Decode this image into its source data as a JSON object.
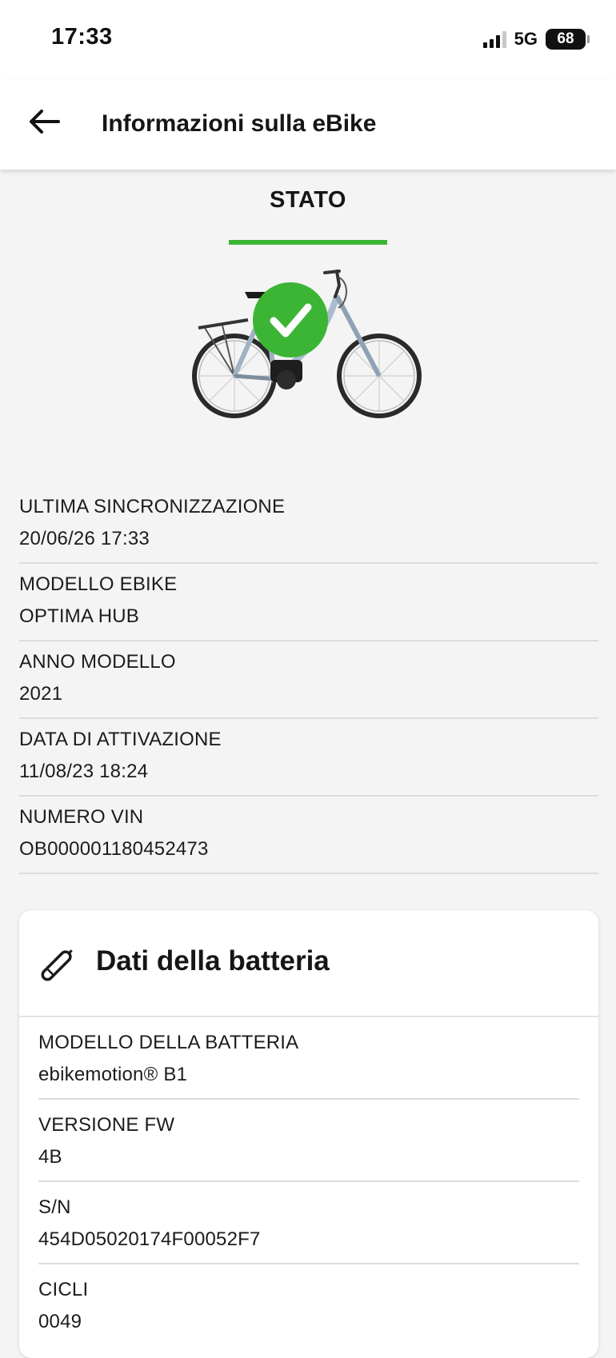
{
  "status_bar": {
    "time": "17:33",
    "network": "5G",
    "battery_level": "68"
  },
  "header": {
    "title": "Informazioni sulla eBike",
    "back_icon": "arrow-left-icon"
  },
  "tabs": [
    {
      "label": "STATO",
      "active": true
    }
  ],
  "status_image": {
    "icon": "check-circle-icon",
    "accent_color": "#3cb534"
  },
  "ebike_info": [
    {
      "label": "ULTIMA SINCRONIZZAZIONE",
      "value": "20/06/26 17:33"
    },
    {
      "label": "MODELLO EBIKE",
      "value": "OPTIMA HUB"
    },
    {
      "label": "ANNO MODELLO",
      "value": "2021"
    },
    {
      "label": "DATA DI ATTIVAZIONE",
      "value": "11/08/23 18:24"
    },
    {
      "label": "NUMERO VIN",
      "value": "OB000001180452473"
    }
  ],
  "battery": {
    "title": "Dati della batteria",
    "icon": "battery-tube-icon",
    "rows": [
      {
        "label": "MODELLO DELLA BATTERIA",
        "value": "ebikemotion® B1"
      },
      {
        "label": "VERSIONE FW",
        "value": "4B"
      },
      {
        "label": "S/N",
        "value": "454D05020174F00052F7"
      },
      {
        "label": "CICLI",
        "value": "0049"
      }
    ]
  }
}
